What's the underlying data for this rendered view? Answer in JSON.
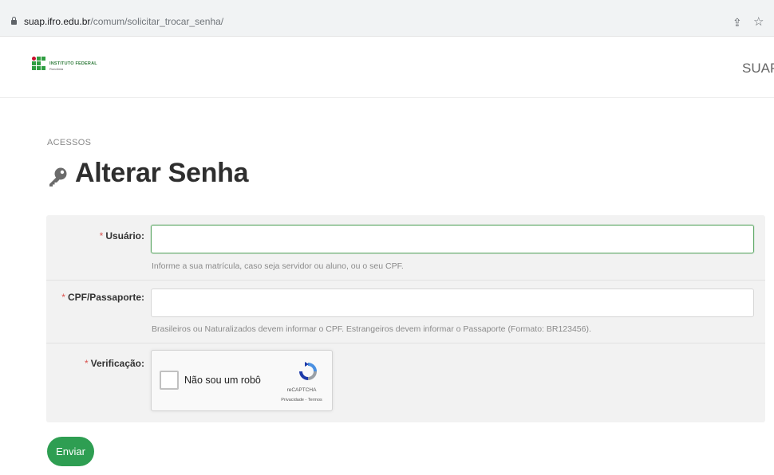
{
  "browser": {
    "url_host": "suap.ifro.edu.br",
    "url_path": "/comum/solicitar_trocar_senha/",
    "icons": [
      "lock-icon",
      "share-icon",
      "star-icon"
    ]
  },
  "header": {
    "logo_title": "INSTITUTO FEDERAL",
    "logo_subtitle": "Rondônia",
    "brand": "SUAP"
  },
  "page": {
    "breadcrumb": "ACESSOS",
    "title": "Alterar Senha",
    "title_icon": "key-icon"
  },
  "form": {
    "required_marker": "*",
    "usuario": {
      "label": "Usuário:",
      "value": "",
      "help": "Informe a sua matrícula, caso seja servidor ou aluno, ou o seu CPF."
    },
    "cpf": {
      "label": "CPF/Passaporte:",
      "value": "",
      "help": "Brasileiros ou Naturalizados devem informar o CPF. Estrangeiros devem informar o Passaporte (Formato: BR123456)."
    },
    "verificacao": {
      "label": "Verificação:",
      "captcha_text": "Não sou um robô",
      "captcha_brand": "reCAPTCHA",
      "captcha_links": "Privacidade - Termos"
    },
    "submit_label": "Enviar"
  },
  "colors": {
    "accent_green": "#2e9e52",
    "required_red": "#d9534f",
    "panel_bg": "#f2f2f2"
  }
}
